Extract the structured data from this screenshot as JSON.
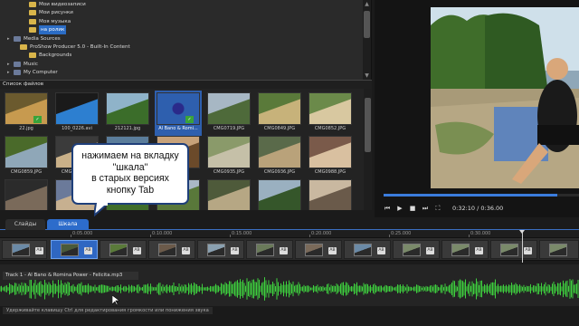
{
  "tree": {
    "items": [
      {
        "label": "Мои видеозаписи",
        "level": 2
      },
      {
        "label": "Мои рисунки",
        "level": 2
      },
      {
        "label": "Моя музыка",
        "level": 2
      },
      {
        "label": "на ролик",
        "level": 2,
        "selected": true
      },
      {
        "label": "Media Sources",
        "level": 0
      },
      {
        "label": "ProShow Producer 5.0 - Built-In Content",
        "level": 1
      },
      {
        "label": "Backgrounds",
        "level": 2
      },
      {
        "label": "Music",
        "level": 0
      },
      {
        "label": "My Computer",
        "level": 0
      }
    ]
  },
  "file_list": {
    "header": "Список файлов",
    "tiles": [
      {
        "caption": "22.jpg",
        "check": true
      },
      {
        "caption": "100_0226.avi",
        "check": false
      },
      {
        "caption": "212121.jpg",
        "check": false
      },
      {
        "caption": "Al Bano & Romi...",
        "check": true,
        "selected": true
      },
      {
        "caption": "CMG0719.JPG",
        "check": false
      },
      {
        "caption": "CMG0849.JPG",
        "check": false
      },
      {
        "caption": "CMG0852.JPG",
        "check": false
      },
      {
        "caption": "CMG0859.JPG",
        "check": false
      },
      {
        "caption": "CMG0868.JPG",
        "check": false
      },
      {
        "caption": "",
        "check": false
      },
      {
        "caption": "",
        "check": false
      },
      {
        "caption": "CMG0935.JPG",
        "check": false
      },
      {
        "caption": "CMG0936.JPG",
        "check": false
      },
      {
        "caption": "CMG0988.JPG",
        "check": false
      },
      {
        "caption": "",
        "check": false
      },
      {
        "caption": "",
        "check": false
      },
      {
        "caption": "",
        "check": false
      },
      {
        "caption": "",
        "check": false
      },
      {
        "caption": "",
        "check": false
      },
      {
        "caption": "",
        "check": false
      },
      {
        "caption": "",
        "check": false
      }
    ]
  },
  "callout": {
    "lines": [
      "нажимаем на вкладку",
      "\"шкала\"",
      "в старых версиях",
      "кнопку Tab"
    ]
  },
  "tabs": [
    {
      "label": "Слайды",
      "active": false
    },
    {
      "label": "Шкала",
      "active": true
    }
  ],
  "preview": {
    "time": "0:32:10 / 0:36.00",
    "progress": 0.89
  },
  "timeline": {
    "ticks": [
      "0:05.000",
      "0:10.000",
      "0:15.000",
      "0:20.000",
      "0:25.000",
      "0:30.000"
    ]
  },
  "audio": {
    "track_label": "Track 1 - Al Bano & Romina Power - Felicita.mp3"
  },
  "status": {
    "hint": "Удерживайте клавишу Ctrl для редактирования громкости или понижения звука"
  },
  "colors": {
    "accent": "#2d6ccb",
    "wave": "#3ecf3e",
    "check": "#3aa33a"
  }
}
